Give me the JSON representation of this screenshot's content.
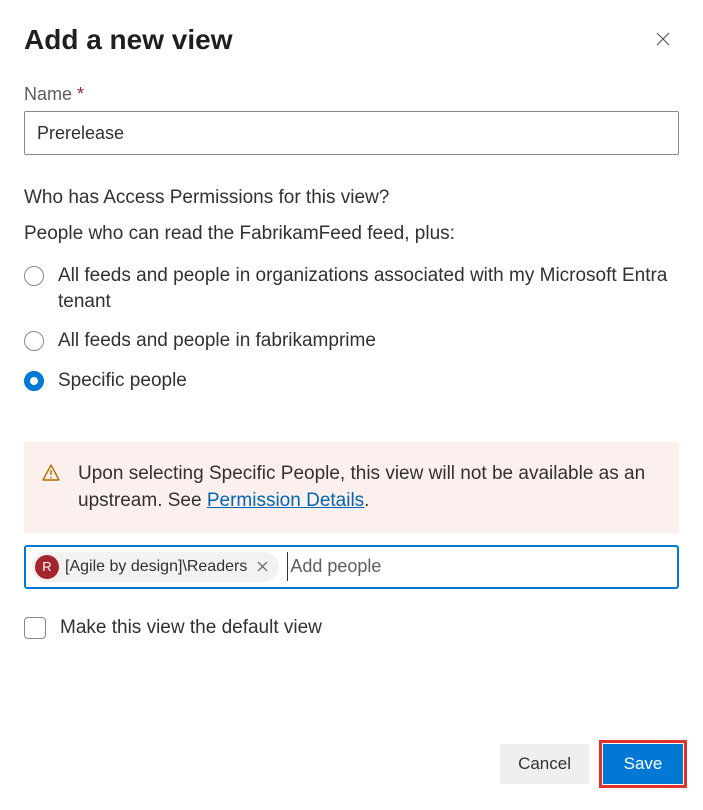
{
  "dialog": {
    "title": "Add a new view"
  },
  "fields": {
    "name_label": "Name",
    "name_value": "Prerelease"
  },
  "permissions": {
    "question": "Who has Access Permissions for this view?",
    "subtitle": "People who can read the FabrikamFeed feed, plus:",
    "options": [
      {
        "label": "All feeds and people in organizations associated with my Microsoft Entra tenant",
        "selected": false
      },
      {
        "label": "All feeds and people in fabrikamprime",
        "selected": false
      },
      {
        "label": "Specific people",
        "selected": true
      }
    ]
  },
  "info": {
    "text_prefix": "Upon selecting Specific People, this view will not be available as an upstream. See ",
    "link_text": "Permission Details",
    "text_suffix": "."
  },
  "picker": {
    "chip_avatar": "R",
    "chip_label": "[Agile by design]\\Readers",
    "placeholder": "Add people"
  },
  "default_view": {
    "label": "Make this view the default view",
    "checked": false
  },
  "buttons": {
    "cancel": "Cancel",
    "save": "Save"
  }
}
